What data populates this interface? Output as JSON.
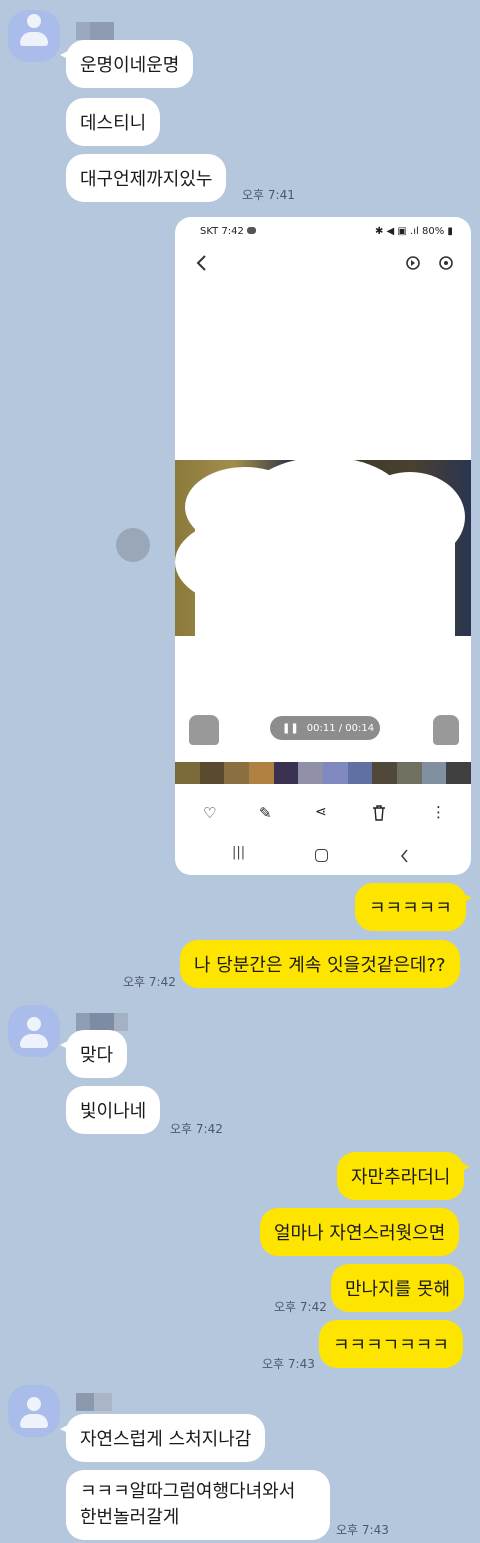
{
  "messages": {
    "m1": "운명이네운명",
    "m2": "데스티니",
    "m3": "대구언제까지있누",
    "t1": "오후 7:41",
    "o1": "ㅋㅋㅋㅋㅋ",
    "o2": "나 당분간은 계속 잇을것같은데??",
    "t2": "오후 7:42",
    "m4": "맞다",
    "m5": "빛이나네",
    "t3": "오후 7:42",
    "o3": "자만추라더니",
    "o4": "얼마나 자연스러웟으면",
    "o5": "만나지를 못해",
    "t4": "오후 7:42",
    "o6": "ㅋㅋㅋㄱㅋㅋㅋ",
    "t5": "오후 7:43",
    "m6": "자연스럽게 스처지나감",
    "m7_line1": "ㅋㅋㅋ알따그럼여행다녀와서",
    "m7_line2": "한번놀러갈게",
    "t6": "오후 7:43"
  },
  "screenshot": {
    "carrier": "SKT",
    "time": "7:42",
    "battery": "80%",
    "video_time": "00:11 / 00:14"
  },
  "colors": {
    "background": "#b4c7dd",
    "incoming": "#ffffff",
    "outgoing": "#fee500",
    "avatar": "#a9bcea"
  }
}
